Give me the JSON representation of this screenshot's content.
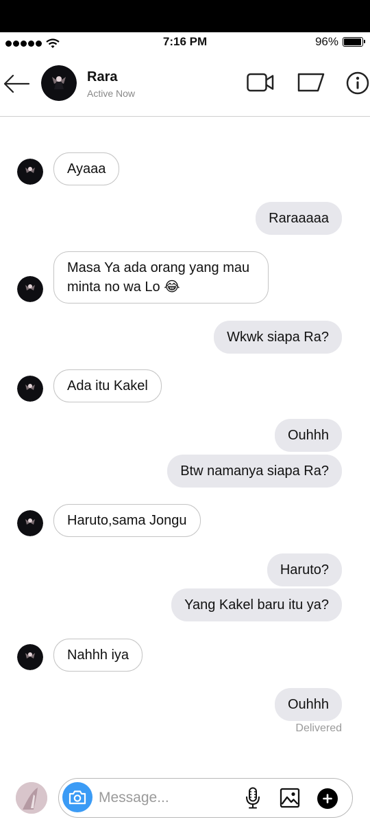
{
  "status_bar": {
    "time": "7:16 PM",
    "battery": "96%",
    "battery_level": 0.96
  },
  "header": {
    "contact_name": "Rara",
    "contact_status": "Active Now"
  },
  "messages": [
    {
      "from": "them",
      "text": "Ayaaa"
    },
    {
      "from": "me",
      "text": "Raraaaaa"
    },
    {
      "from": "them",
      "text": "Masa Ya ada orang yang mau minta no wa Lo 😂"
    },
    {
      "from": "me",
      "text": "Wkwk siapa Ra?"
    },
    {
      "from": "them",
      "text": "Ada itu Kakel"
    },
    {
      "from": "me",
      "text": "Ouhhh"
    },
    {
      "from": "me",
      "text": "Btw namanya siapa Ra?"
    },
    {
      "from": "them",
      "text": "Haruto,sama Jongu"
    },
    {
      "from": "me",
      "text": "Haruto?"
    },
    {
      "from": "me",
      "text": "Yang Kakel baru itu ya?"
    },
    {
      "from": "them",
      "text": "Nahhh iya"
    },
    {
      "from": "me",
      "text": "Ouhhh"
    }
  ],
  "receipt": "Delivered",
  "composer": {
    "placeholder": "Message..."
  },
  "colors": {
    "accent_blue": "#3b9bf5",
    "outgoing_bubble": "#e7e7ec",
    "incoming_border": "#c4c4c4"
  }
}
